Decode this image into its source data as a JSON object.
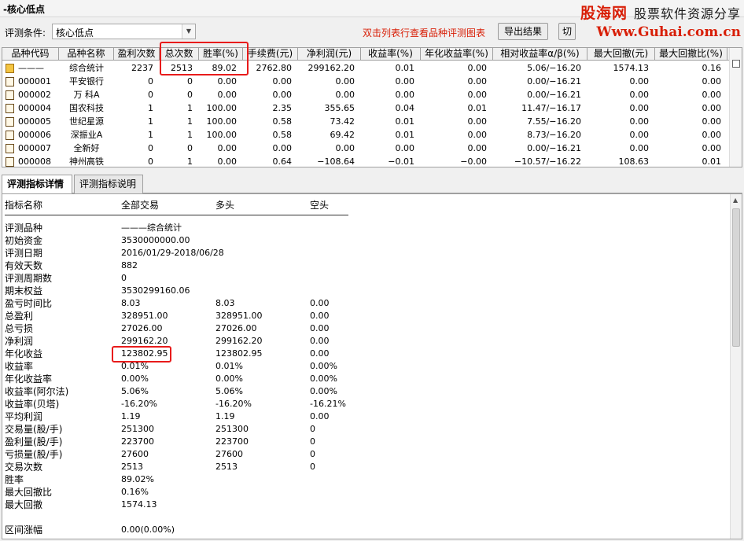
{
  "window": {
    "title": "-核心低点"
  },
  "watermark": {
    "line1_a": "股海网",
    "line1_b": "股票软件资源分享",
    "line2": "Www.Guhai.com.cn"
  },
  "toolbar": {
    "condition_label": "评测条件:",
    "condition_value": "核心低点",
    "hint": "双击列表行查看品种评测图表",
    "export_label": "导出结果",
    "other_label": "切"
  },
  "grid": {
    "headers": [
      "品种代码",
      "品种名称",
      "盈利次数",
      "总次数",
      "胜率(%)",
      "手续费(元)",
      "净利润(元)",
      "收益率(%)",
      "年化收益率(%)",
      "相对收益率α/β(%)",
      "最大回撤(元)",
      "最大回撤比(%)"
    ],
    "rows": [
      {
        "code": "———",
        "name": "综合统计",
        "win": "2237",
        "total": "2513",
        "rate": "89.02",
        "fee": "2762.80",
        "profit": "299162.20",
        "ret": "0.01",
        "annual": "0.00",
        "alpha": "5.06/−16.20",
        "dd": "1574.13",
        "ddr": "0.16"
      },
      {
        "code": "000001",
        "name": "平安银行",
        "win": "0",
        "total": "0",
        "rate": "0.00",
        "fee": "0.00",
        "profit": "0.00",
        "ret": "0.00",
        "annual": "0.00",
        "alpha": "0.00/−16.21",
        "dd": "0.00",
        "ddr": "0.00"
      },
      {
        "code": "000002",
        "name": "万 科A",
        "win": "0",
        "total": "0",
        "rate": "0.00",
        "fee": "0.00",
        "profit": "0.00",
        "ret": "0.00",
        "annual": "0.00",
        "alpha": "0.00/−16.21",
        "dd": "0.00",
        "ddr": "0.00"
      },
      {
        "code": "000004",
        "name": "国农科技",
        "win": "1",
        "total": "1",
        "rate": "100.00",
        "fee": "2.35",
        "profit": "355.65",
        "ret": "0.04",
        "annual": "0.01",
        "alpha": "11.47/−16.17",
        "dd": "0.00",
        "ddr": "0.00"
      },
      {
        "code": "000005",
        "name": "世纪星源",
        "win": "1",
        "total": "1",
        "rate": "100.00",
        "fee": "0.58",
        "profit": "73.42",
        "ret": "0.01",
        "annual": "0.00",
        "alpha": "7.55/−16.20",
        "dd": "0.00",
        "ddr": "0.00"
      },
      {
        "code": "000006",
        "name": "深振业A",
        "win": "1",
        "total": "1",
        "rate": "100.00",
        "fee": "0.58",
        "profit": "69.42",
        "ret": "0.01",
        "annual": "0.00",
        "alpha": "8.73/−16.20",
        "dd": "0.00",
        "ddr": "0.00"
      },
      {
        "code": "000007",
        "name": "全新好",
        "win": "0",
        "total": "0",
        "rate": "0.00",
        "fee": "0.00",
        "profit": "0.00",
        "ret": "0.00",
        "annual": "0.00",
        "alpha": "0.00/−16.21",
        "dd": "0.00",
        "ddr": "0.00"
      },
      {
        "code": "000008",
        "name": "神州高铁",
        "win": "0",
        "total": "1",
        "rate": "0.00",
        "fee": "0.64",
        "profit": "−108.64",
        "ret": "−0.01",
        "annual": "−0.00",
        "alpha": "−10.57/−16.22",
        "dd": "108.63",
        "ddr": "0.01"
      }
    ]
  },
  "tabs": [
    {
      "label": "评测指标详情"
    },
    {
      "label": "评测指标说明"
    }
  ],
  "detail": {
    "headers": [
      "指标名称",
      "全部交易",
      "多头",
      "空头"
    ],
    "rows": [
      {
        "name": "评测品种",
        "all": "———综合统计",
        "long": "",
        "short": ""
      },
      {
        "name": "初始资金",
        "all": "3530000000.00",
        "long": "",
        "short": ""
      },
      {
        "name": "评测日期",
        "all": "2016/01/29-2018/06/28",
        "long": "",
        "short": ""
      },
      {
        "name": "有效天数",
        "all": "882",
        "long": "",
        "short": ""
      },
      {
        "name": "评测周期数",
        "all": "0",
        "long": "",
        "short": ""
      },
      {
        "name": "期末权益",
        "all": "3530299160.06",
        "long": "",
        "short": ""
      },
      {
        "name": "盈亏时间比",
        "all": "8.03",
        "long": "8.03",
        "short": "0.00"
      },
      {
        "name": "总盈利",
        "all": "328951.00",
        "long": "328951.00",
        "short": "0.00"
      },
      {
        "name": "总亏损",
        "all": "27026.00",
        "long": "27026.00",
        "short": "0.00"
      },
      {
        "name": "净利润",
        "all": "299162.20",
        "long": "299162.20",
        "short": "0.00"
      },
      {
        "name": "年化收益",
        "all": "123802.95",
        "long": "123802.95",
        "short": "0.00"
      },
      {
        "name": "收益率",
        "all": "0.01%",
        "long": "0.01%",
        "short": "0.00%"
      },
      {
        "name": "年化收益率",
        "all": "0.00%",
        "long": "0.00%",
        "short": "0.00%"
      },
      {
        "name": "收益率(阿尔法)",
        "all": "5.06%",
        "long": "5.06%",
        "short": "0.00%"
      },
      {
        "name": "收益率(贝塔)",
        "all": "-16.20%",
        "long": "-16.20%",
        "short": "-16.21%"
      },
      {
        "name": "平均利润",
        "all": "1.19",
        "long": "1.19",
        "short": "0.00"
      },
      {
        "name": "交易量(股/手)",
        "all": "251300",
        "long": "251300",
        "short": "0"
      },
      {
        "name": "盈利量(股/手)",
        "all": "223700",
        "long": "223700",
        "short": "0"
      },
      {
        "name": "亏损量(股/手)",
        "all": "27600",
        "long": "27600",
        "short": "0"
      },
      {
        "name": "交易次数",
        "all": "2513",
        "long": "2513",
        "short": "0"
      },
      {
        "name": "胜率",
        "all": "89.02%",
        "long": "",
        "short": ""
      },
      {
        "name": "最大回撤比",
        "all": "0.16%",
        "long": "",
        "short": ""
      },
      {
        "name": "最大回撤",
        "all": "1574.13",
        "long": "",
        "short": ""
      },
      {
        "name": "",
        "all": "",
        "long": "",
        "short": ""
      },
      {
        "name": "区间涨幅",
        "all": "0.00(0.00%)",
        "long": "",
        "short": ""
      }
    ]
  },
  "colors": {
    "highlight": "#e81b1b",
    "hint": "#d81e06"
  }
}
